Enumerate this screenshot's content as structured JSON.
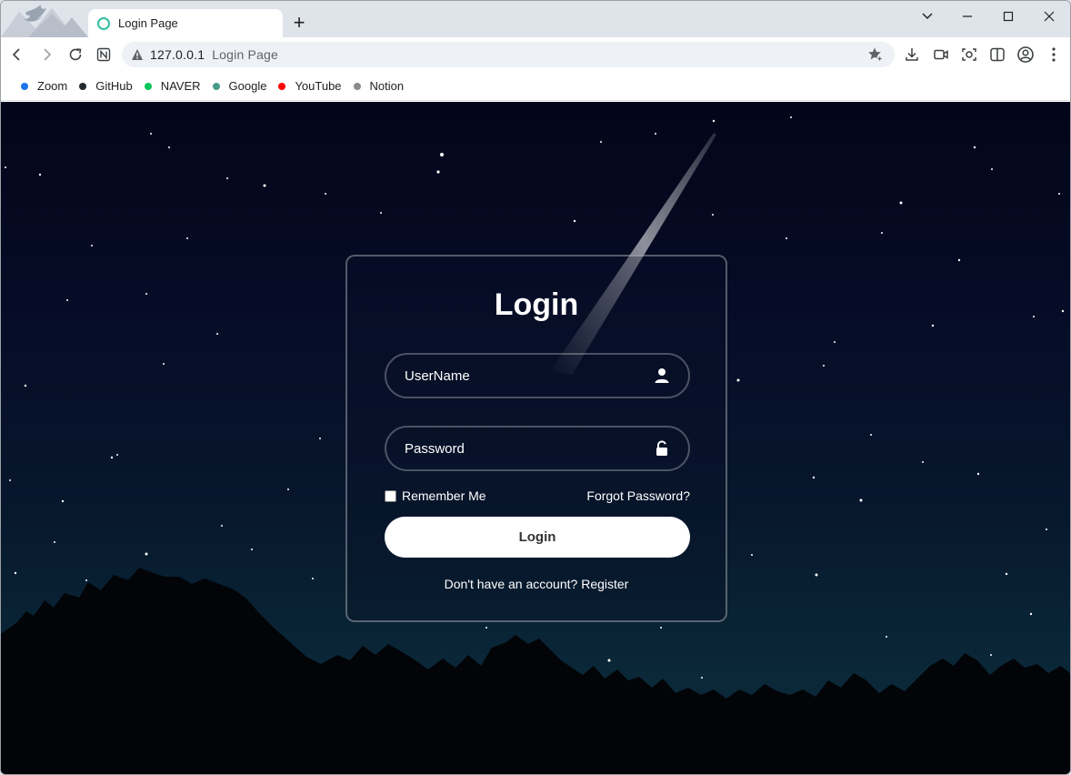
{
  "browser": {
    "tab_title": "Login Page",
    "new_tab_symbol": "+",
    "address_host": "127.0.0.1",
    "address_title": "Login Page",
    "address_icon": "warning-triangle-icon",
    "bookmarks": [
      {
        "label": "Zoom",
        "color": "#1a73e8"
      },
      {
        "label": "GitHub",
        "color": "#24292f"
      },
      {
        "label": "NAVER",
        "color": "#03c75a"
      },
      {
        "label": "Google",
        "color": "#4a9c8a"
      },
      {
        "label": "YouTube",
        "color": "#ff0000"
      },
      {
        "label": "Notion",
        "color": "#8a8a8a"
      }
    ]
  },
  "login": {
    "title": "Login",
    "username_placeholder": "UserName",
    "password_placeholder": "Password",
    "username_icon": "user-icon",
    "password_icon": "lock-icon",
    "remember_label": "Remember Me",
    "forgot_label": "Forgot Password?",
    "button_label": "Login",
    "register_prefix": "Don't have an account?",
    "register_link": "Register"
  },
  "colors": {
    "sky_top": "#03061a",
    "sky_bottom": "#0b2a36",
    "accent_white": "#ffffff"
  }
}
